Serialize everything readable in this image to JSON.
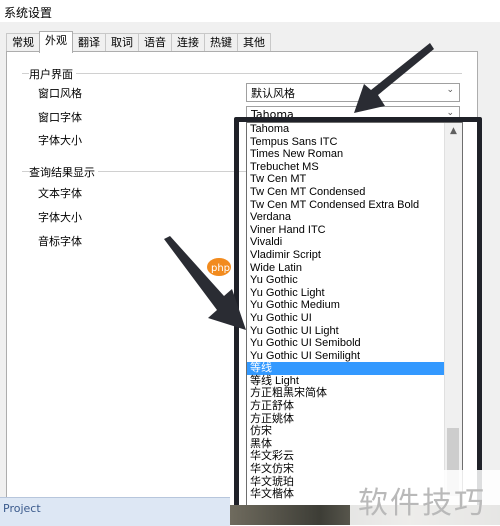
{
  "window": {
    "title": "系统设置"
  },
  "tabs": [
    "常规",
    "外观",
    "翻译",
    "取词",
    "语音",
    "连接",
    "热键",
    "其他"
  ],
  "active_tab": "外观",
  "ui_group": {
    "title": "用户界面",
    "window_style_label": "窗口风格",
    "window_style_value": "默认风格",
    "window_font_label": "窗口字体",
    "window_font_value": "Tahoma",
    "font_size_label": "字体大小"
  },
  "result_group": {
    "title": "查询结果显示",
    "text_font_label": "文本字体",
    "font_size_label": "字体大小",
    "phonetic_font_label": "音标字体"
  },
  "font_list": [
    "Tahoma",
    "Tempus Sans ITC",
    "Times New Roman",
    "Trebuchet MS",
    "Tw Cen MT",
    "Tw Cen MT Condensed",
    "Tw Cen MT Condensed Extra Bold",
    "Verdana",
    "Viner Hand ITC",
    "Vivaldi",
    "Vladimir Script",
    "Wide Latin",
    "Yu Gothic",
    "Yu Gothic Light",
    "Yu Gothic Medium",
    "Yu Gothic UI",
    "Yu Gothic UI Light",
    "Yu Gothic UI Semibold",
    "Yu Gothic UI Semilight",
    "等线",
    "等线 Light",
    "方正粗黑宋简体",
    "方正舒体",
    "方正姚体",
    "仿宋",
    "黑体",
    "华文彩云",
    "华文仿宋",
    "华文琥珀",
    "华文楷体"
  ],
  "selected_font": "等线",
  "colors": {
    "selection": "#3399ff",
    "frame": "#1f2128",
    "arrow": "#2a2c33"
  },
  "bottom_panel": {
    "label": "Project"
  },
  "watermark": {
    "logo_text": "php 中文网",
    "text": "软件技巧"
  }
}
